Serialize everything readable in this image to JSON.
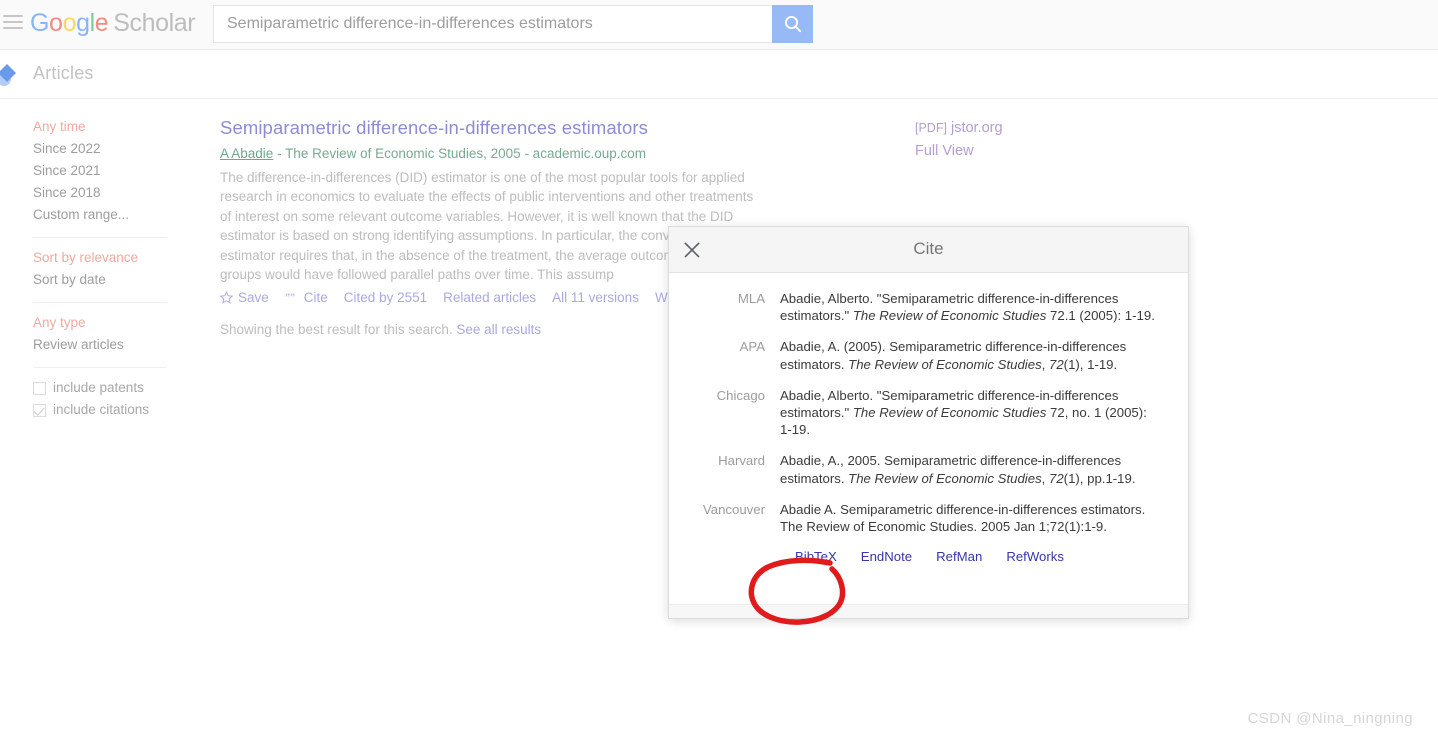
{
  "header": {
    "menu_icon": "hamburger-icon",
    "logo": {
      "google": "Google",
      "scholar": "Scholar"
    },
    "search": {
      "value": "Semiparametric difference-in-differences estimators",
      "placeholder": "",
      "button_icon": "search-icon"
    }
  },
  "nav": {
    "articles_label": "Articles",
    "pointer_icon": "cursor-arrow-icon"
  },
  "sidebar": {
    "time_filters": [
      {
        "label": "Any time",
        "active": true
      },
      {
        "label": "Since 2022",
        "active": false
      },
      {
        "label": "Since 2021",
        "active": false
      },
      {
        "label": "Since 2018",
        "active": false
      },
      {
        "label": "Custom range...",
        "active": false
      }
    ],
    "sort_filters": [
      {
        "label": "Sort by relevance",
        "active": true
      },
      {
        "label": "Sort by date",
        "active": false
      }
    ],
    "type_filters": [
      {
        "label": "Any type",
        "active": true
      },
      {
        "label": "Review articles",
        "active": false
      }
    ],
    "checkboxes": [
      {
        "label": "include patents",
        "checked": false
      },
      {
        "label": "include citations",
        "checked": true
      }
    ]
  },
  "result": {
    "title": "Semiparametric difference-in-differences estimators",
    "author": "A Abadie",
    "meta_rest": " - The Review of Economic Studies, 2005 - academic.oup.com",
    "snippet": "The difference-in-differences (DID) estimator is one of the most popular tools for applied research in economics to evaluate the effects of public interventions and other treatments of interest on some relevant outcome variables. However, it is well known that the DID estimator is based on strong identifying assumptions. In particular, the conventional DID estimator requires that, in the absence of the treatment, the average outcome and control groups would have followed parallel paths over time. This assump",
    "actions": {
      "save": "Save",
      "cite": "Cite",
      "cited_by": "Cited by 2551",
      "related": "Related articles",
      "versions": "All 11 versions",
      "web": "Web"
    },
    "best_result_text": "Showing the best result for this search.",
    "see_all_results": "See all results",
    "right_links": [
      {
        "tag": "[PDF]",
        "label": "jstor.org"
      },
      {
        "tag": "",
        "label": "Full View"
      }
    ]
  },
  "cite_dialog": {
    "title": "Cite",
    "close_icon": "close-icon",
    "citations": [
      {
        "style": "MLA",
        "parts": [
          {
            "text": "Abadie, Alberto. \"Semiparametric difference-in-differences estimators.\" ",
            "italic": false
          },
          {
            "text": "The Review of Economic Studies",
            "italic": true
          },
          {
            "text": " 72.1 (2005): 1-19.",
            "italic": false
          }
        ]
      },
      {
        "style": "APA",
        "parts": [
          {
            "text": "Abadie, A. (2005). Semiparametric difference-in-differences estimators. ",
            "italic": false
          },
          {
            "text": "The Review of Economic Studies",
            "italic": true
          },
          {
            "text": ", ",
            "italic": false
          },
          {
            "text": "72",
            "italic": true
          },
          {
            "text": "(1), 1-19.",
            "italic": false
          }
        ]
      },
      {
        "style": "Chicago",
        "parts": [
          {
            "text": "Abadie, Alberto. \"Semiparametric difference-in-differences estimators.\" ",
            "italic": false
          },
          {
            "text": "The Review of Economic Studies",
            "italic": true
          },
          {
            "text": " 72, no. 1 (2005): 1-19.",
            "italic": false
          }
        ]
      },
      {
        "style": "Harvard",
        "parts": [
          {
            "text": "Abadie, A., 2005. Semiparametric difference-in-differences estimators. ",
            "italic": false
          },
          {
            "text": "The Review of Economic Studies",
            "italic": true
          },
          {
            "text": ", ",
            "italic": false
          },
          {
            "text": "72",
            "italic": true
          },
          {
            "text": "(1), pp.1-19.",
            "italic": false
          }
        ]
      },
      {
        "style": "Vancouver",
        "parts": [
          {
            "text": "Abadie A. Semiparametric difference-in-differences estimators. The Review of Economic Studies. 2005 Jan 1;72(1):1-9.",
            "italic": false
          }
        ]
      }
    ],
    "exports": [
      "BibTeX",
      "EndNote",
      "RefMan",
      "RefWorks"
    ],
    "annotation": {
      "type": "hand-drawn-circle",
      "target": "BibTeX",
      "color": "#e01b1b"
    }
  },
  "watermark": "CSDN @Nina_ningning",
  "colors": {
    "accent_link": "#a9a9e0",
    "filter_active": "#f0a9a0",
    "export_link": "#3836a8",
    "annotation_red": "#e01b1b"
  }
}
